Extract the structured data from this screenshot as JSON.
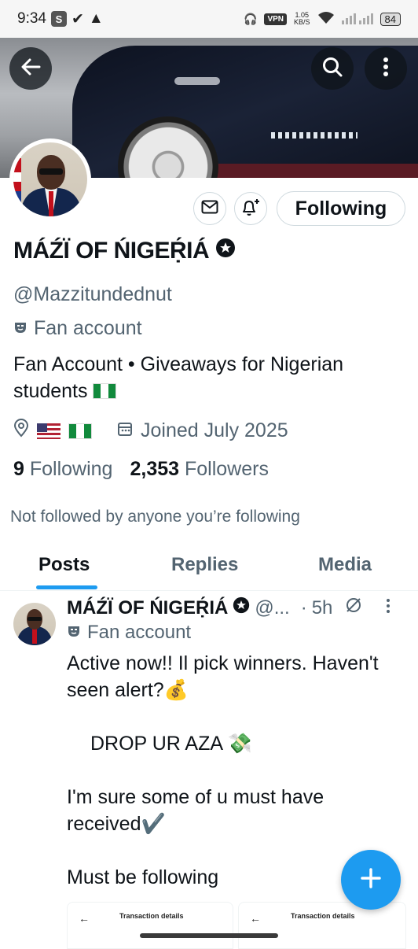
{
  "status_bar": {
    "time": "9:34",
    "s_badge": "S",
    "vpn": "VPN",
    "speed_value": "1.05",
    "speed_unit": "KB/S",
    "battery": "84"
  },
  "profile": {
    "display_name": "MÁŹÏ OF ŃIGEṚ́IÁ",
    "handle": "@Mazzitundednut",
    "category": "Fan account",
    "bio": "Fan Account • Giveaways for Nigerian students",
    "joined": "Joined July 2025",
    "following_count": "9",
    "following_label": "Following",
    "followers_count": "2,353",
    "followers_label": "Followers",
    "not_followed_text": "Not followed by anyone you’re following",
    "follow_button": "Following"
  },
  "tabs": [
    {
      "label": "Posts",
      "active": true
    },
    {
      "label": "Replies",
      "active": false
    },
    {
      "label": "Media",
      "active": false
    }
  ],
  "post": {
    "author": "MÁŹÏ OF ŃIGEṚ́IÁ",
    "handle_truncated": "@...",
    "dot": "·",
    "time": "5h",
    "category": "Fan account",
    "lines": [
      "Active now!! Il pick winners. Haven't seen alert?💰",
      "",
      "    DROP UR AZA 💸",
      "",
      "I'm sure some of u must have received✔️",
      "",
      "Must be following"
    ],
    "attachments": [
      {
        "title": "Transaction details"
      },
      {
        "title": "Transaction details"
      }
    ]
  },
  "colors": {
    "accent": "#1d9bf0",
    "text": "#0f1419",
    "muted": "#536471"
  }
}
